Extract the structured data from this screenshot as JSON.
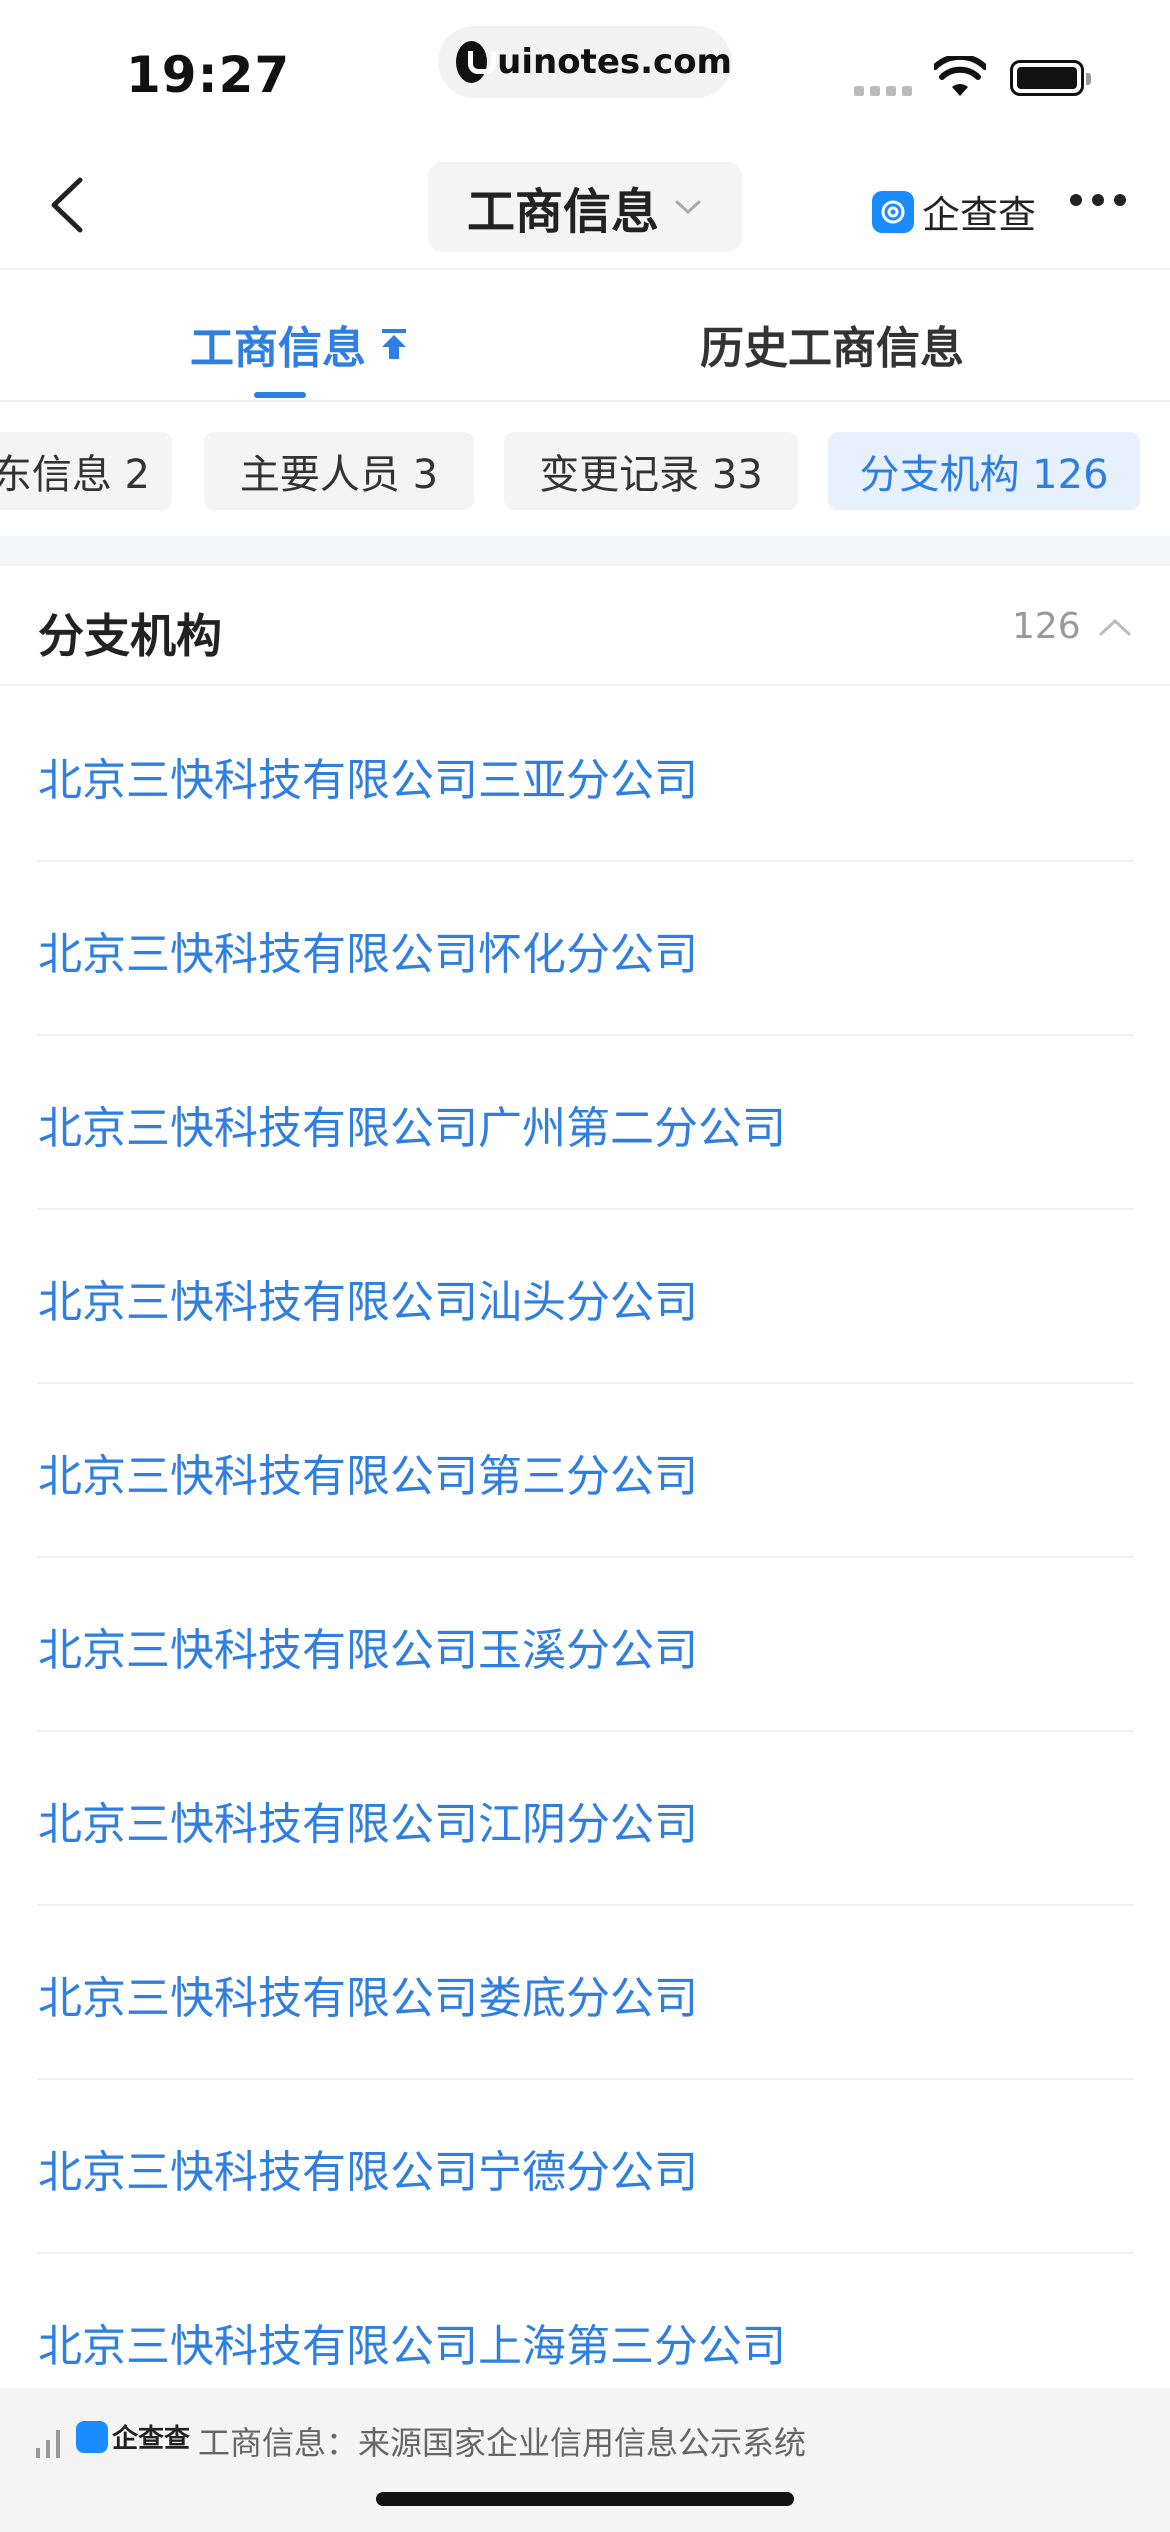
{
  "status_bar": {
    "time": "19:27",
    "url": "uinotes.com"
  },
  "nav": {
    "title": "工商信息",
    "brand": "企查查"
  },
  "main_tabs": {
    "active": "工商信息",
    "history": "历史工商信息"
  },
  "sub_tabs": [
    {
      "label": "东信息 2"
    },
    {
      "label": "主要人员 3"
    },
    {
      "label": "变更记录 33"
    },
    {
      "label": "分支机构 126",
      "active": true
    }
  ],
  "section": {
    "title": "分支机构",
    "count": "126"
  },
  "branches": [
    "北京三快科技有限公司三亚分公司",
    "北京三快科技有限公司怀化分公司",
    "北京三快科技有限公司广州第二分公司",
    "北京三快科技有限公司汕头分公司",
    "北京三快科技有限公司第三分公司",
    "北京三快科技有限公司玉溪分公司",
    "北京三快科技有限公司江阴分公司",
    "北京三快科技有限公司娄底分公司",
    "北京三快科技有限公司宁德分公司",
    "北京三快科技有限公司上海第三分公司"
  ],
  "footer": {
    "brand": "企查查",
    "source_text": "工商信息：来源国家企业信用信息公示系统"
  },
  "colors": {
    "accent": "#2f7fe0",
    "chip_active_bg": "#e6f1fd",
    "brand_blue": "#1a8cff"
  }
}
